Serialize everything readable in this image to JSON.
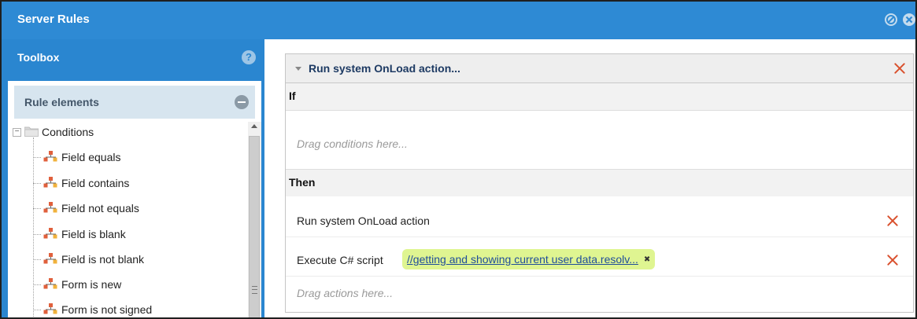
{
  "window": {
    "title": "Server Rules"
  },
  "toolbox": {
    "title": "Toolbox",
    "help_symbol": "?",
    "section_title": "Rule elements",
    "tree": {
      "root": {
        "label": "Conditions",
        "icon": "folder-icon",
        "expander": "−"
      },
      "items": [
        {
          "label": "Field equals",
          "icon": "rule-element-icon"
        },
        {
          "label": "Field contains",
          "icon": "rule-element-icon"
        },
        {
          "label": "Field not equals",
          "icon": "rule-element-icon"
        },
        {
          "label": "Field is blank",
          "icon": "rule-element-icon"
        },
        {
          "label": "Field is not blank",
          "icon": "rule-element-icon"
        },
        {
          "label": "Form is new",
          "icon": "rule-element-icon"
        },
        {
          "label": "Form is not signed",
          "icon": "rule-element-icon"
        }
      ]
    }
  },
  "rule": {
    "title": "Run system OnLoad action...",
    "if_label": "If",
    "conditions_placeholder": "Drag conditions here...",
    "then_label": "Then",
    "actions": [
      {
        "label": "Run system OnLoad action"
      },
      {
        "label": "Execute C# script",
        "script_link": "//getting and showing current user data.resolv...",
        "remove_symbol": "✖"
      }
    ],
    "actions_placeholder": "Drag actions here..."
  },
  "colors": {
    "titlebar": "#2e8ad4",
    "toolbox_bg": "#2a86d0",
    "section_bg": "#d7e5ef",
    "delete_red": "#d9502d",
    "script_chip": "#dff591",
    "rule_title": "#1d3a63"
  }
}
